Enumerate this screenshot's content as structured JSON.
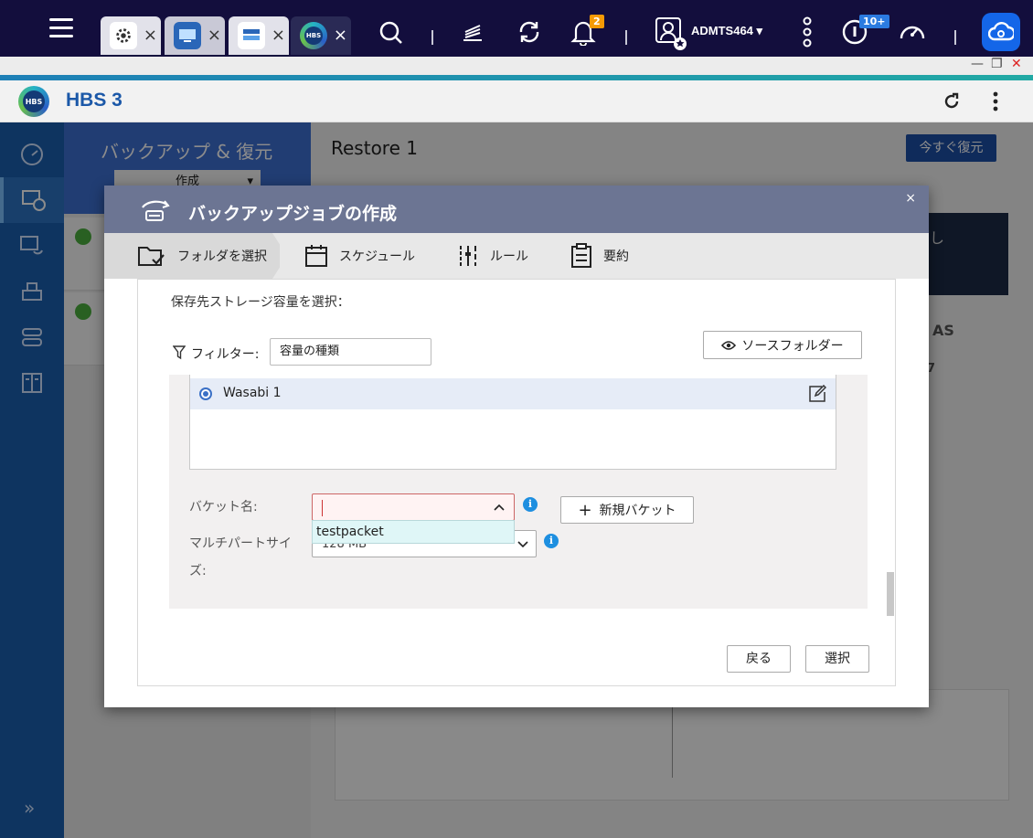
{
  "taskbar": {
    "app_tabs": [
      {
        "icon": "gear-icon"
      },
      {
        "icon": "monitor-app-icon"
      },
      {
        "icon": "storage-app-icon"
      },
      {
        "icon": "hbs-app-icon",
        "label": "HBS"
      }
    ],
    "notification_count": "2",
    "user_name": "ADMTS464",
    "updates_count": "10+"
  },
  "app": {
    "logo_text": "HBS",
    "title": "HBS 3"
  },
  "background": {
    "panel_title": "バックアップ & 復元",
    "create_label": "作成",
    "main_title": "Restore 1",
    "restore_now_label": "今すぐ復元",
    "partial_label_1": "し",
    "partial_label_2": "AS",
    "partial_label_3": "7"
  },
  "dialog": {
    "title": "バックアップジョブの作成",
    "close_label": "×",
    "steps": [
      {
        "label": "フォルダを選択",
        "icon": "folder-check-icon",
        "active": true
      },
      {
        "label": "スケジュール",
        "icon": "calendar-icon",
        "active": false
      },
      {
        "label": "ルール",
        "icon": "sliders-icon",
        "active": false
      },
      {
        "label": "要約",
        "icon": "clipboard-icon",
        "active": false
      }
    ],
    "section_label": "保存先ストレージ容量を選択：",
    "filter": {
      "label": "フィルター:",
      "value": "容量の種類"
    },
    "source_folder_label": "ソースフォルダー",
    "storage_items": [
      {
        "name": "Wasabi 1",
        "selected": true
      }
    ],
    "bucket": {
      "label": "バケット名:",
      "value": "",
      "dropdown_options": [
        "testpacket"
      ],
      "new_bucket_label": "新規バケット"
    },
    "multipart": {
      "label_line1": "マルチパートサイ",
      "label_line2": "ズ:",
      "value": "128 MB"
    },
    "buttons": {
      "back": "戻る",
      "select": "選択"
    }
  },
  "colors": {
    "taskbar": "#130e3d",
    "dialog_header": "#6c7593",
    "accent": "#1d4fa7",
    "nav": "#1a5fb0",
    "badge": "#f59a05"
  }
}
